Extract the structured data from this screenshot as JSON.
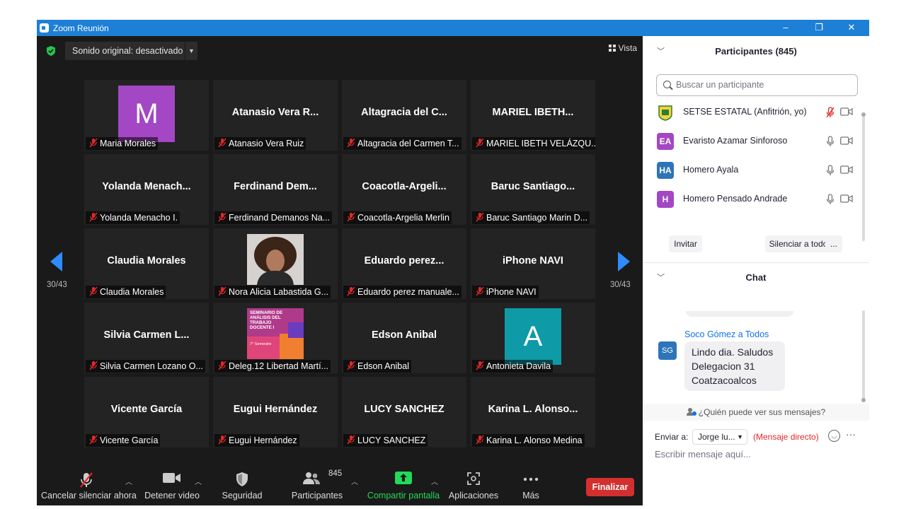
{
  "window": {
    "title": "Zoom Reunión",
    "controls": [
      "–",
      "❐",
      "✕"
    ]
  },
  "meeting": {
    "sound_label": "Sonido original: desactivado",
    "view_label": "Vista",
    "page_left": "30/43",
    "page_right": "30/43",
    "tiles": [
      {
        "big": "",
        "label": "Maria Morales",
        "avatar": {
          "letter": "M",
          "color": "#a347c4"
        }
      },
      {
        "big": "Atanasio Vera R...",
        "label": "Atanasio Vera Ruiz"
      },
      {
        "big": "Altagracia del C...",
        "label": "Altagracia del Carmen T..."
      },
      {
        "big": "MARIEL IBETH...",
        "label": "MARIEL IBETH VELÁZQU..."
      },
      {
        "big": "Yolanda Menach...",
        "label": "Yolanda Menacho I."
      },
      {
        "big": "Ferdinand Dem...",
        "label": "Ferdinand Demanos Na..."
      },
      {
        "big": "Coacotla-Argeli...",
        "label": "Coacotla-Argelia Merlin"
      },
      {
        "big": "Baruc Santiago...",
        "label": "Baruc Santiago Marin D..."
      },
      {
        "big": "Claudia Morales",
        "label": "Claudia Morales"
      },
      {
        "big": "",
        "label": "Nora Alicia Labastida G...",
        "photo": "portrait"
      },
      {
        "big": "Eduardo perez...",
        "label": "Eduardo perez manuale..."
      },
      {
        "big": "iPhone NAVI",
        "label": "iPhone NAVI"
      },
      {
        "big": "Silvia Carmen L...",
        "label": "Silvia Carmen Lozano O..."
      },
      {
        "big": "",
        "label": "Deleg.12 Libertad Martí...",
        "poster": {
          "l1": "SEMINARIO DE",
          "l2": "ANÁLISIS DEL",
          "l3": "TRABAJO",
          "l4": "DOCENTE I",
          "l5": "7° Semestre"
        }
      },
      {
        "big": "Edson Anibal",
        "label": "Edson Anibal"
      },
      {
        "big": "",
        "label": "Antonieta Davila",
        "avatar": {
          "letter": "A",
          "color": "#0e9aa7"
        }
      },
      {
        "big": "Vicente García",
        "label": "Vicente García"
      },
      {
        "big": "Eugui Hernández",
        "label": "Eugui Hernández"
      },
      {
        "big": "LUCY SANCHEZ",
        "label": "LUCY SANCHEZ"
      },
      {
        "big": "Karina L. Alonso...",
        "label": "Karina L. Alonso Medina"
      }
    ]
  },
  "toolbar": {
    "unmute": "Cancelar silenciar ahora",
    "stop_video": "Detener video",
    "security": "Seguridad",
    "participants": "Participantes",
    "participants_count": "845",
    "share": "Compartir pantalla",
    "apps": "Aplicaciones",
    "more": "Más",
    "end": "Finalizar",
    "colors": {
      "share_green": "#23d959",
      "end_red": "#d32f2f"
    }
  },
  "participants_panel": {
    "title": "Participantes (845)",
    "search_placeholder": "Buscar un participante",
    "rows": [
      {
        "initials": "",
        "name": "SETSE ESTATAL (Anfitrión, yo)",
        "color": "#ffffff",
        "muted": true
      },
      {
        "initials": "EA",
        "name": "Evaristo Azamar Sinforoso",
        "color": "#a347c4",
        "muted": false
      },
      {
        "initials": "HA",
        "name": "Homero Ayala",
        "color": "#2d75b8",
        "muted": false
      },
      {
        "initials": "H",
        "name": "Homero Pensado Andrade",
        "color": "#a347c4",
        "muted": false
      }
    ],
    "invite": "Invitar",
    "mute_all": "Silenciar a todos",
    "more": "..."
  },
  "chat_panel": {
    "title": "Chat",
    "sender": "Soco Gómez a Todos",
    "sender_initials": "SG",
    "message_lines": [
      "Lindo dia. Saludos",
      "Delegacion 31",
      "Coatzacoalcos"
    ],
    "who_can_see": "¿Quién puede ver sus mensajes?",
    "send_to_label": "Enviar a:",
    "send_to_value": "Jorge lu...",
    "direct_label": "(Mensaje directo)",
    "more": "···",
    "input_placeholder": "Escribir mensaje aquí..."
  }
}
